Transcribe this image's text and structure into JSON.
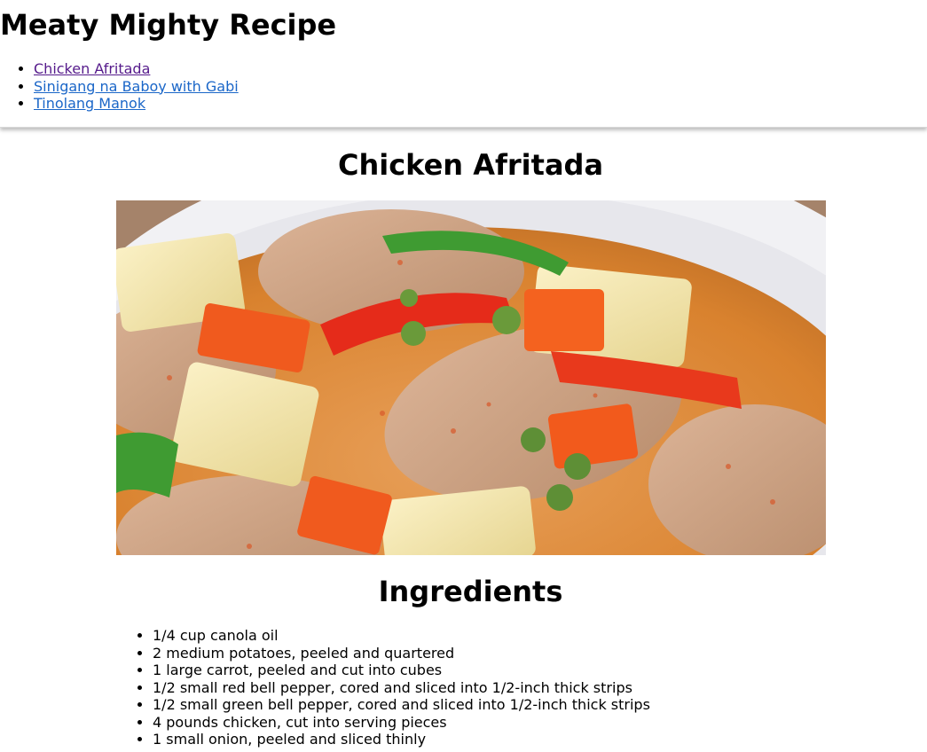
{
  "header": {
    "site_title": "Meaty Mighty Recipe",
    "nav": [
      {
        "label": "Chicken Afritada",
        "visited": true
      },
      {
        "label": "Sinigang na Baboy with Gabi",
        "visited": false
      },
      {
        "label": "Tinolang Manok",
        "visited": false
      }
    ]
  },
  "recipe": {
    "title": "Chicken Afritada",
    "image_subject": "chicken-afritada-dish",
    "ingredients_heading": "Ingredients",
    "ingredients": [
      "1/4 cup canola oil",
      "2 medium potatoes, peeled and quartered",
      "1 large carrot, peeled and cut into cubes",
      "1/2 small red bell pepper, cored and sliced into 1/2-inch thick strips",
      "1/2 small green bell pepper, cored and sliced into 1/2-inch thick strips",
      "4 pounds chicken, cut into serving pieces",
      "1 small onion, peeled and sliced thinly"
    ]
  },
  "colors": {
    "link": "#1a66c8",
    "link_visited": "#551a8b"
  }
}
